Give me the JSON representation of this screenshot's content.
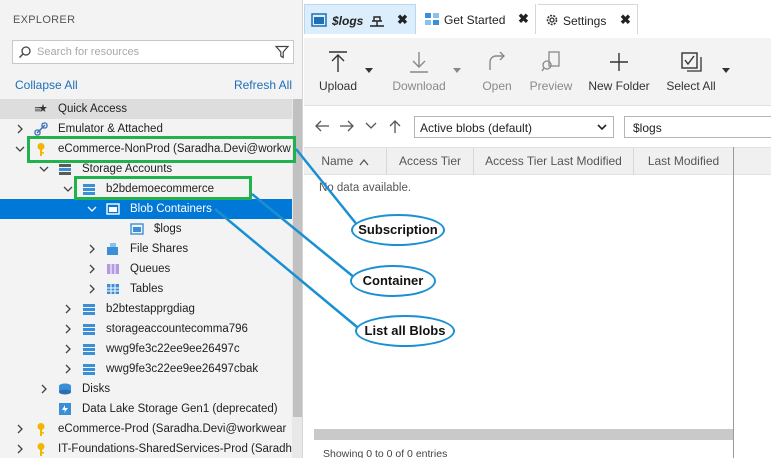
{
  "explorer": {
    "title": "EXPLORER",
    "search_placeholder": "Search for resources",
    "collapse_all": "Collapse All",
    "refresh_all": "Refresh All"
  },
  "tree": {
    "quick_access": "Quick Access",
    "emulator": "Emulator & Attached",
    "subscription": "eCommerce-NonProd (Saradha.Devi@workw",
    "storage_accounts": "Storage Accounts",
    "account": "b2bdemoecommerce",
    "blob_containers": "Blob Containers",
    "logs_container": "$logs",
    "file_shares": "File Shares",
    "queues": "Queues",
    "tables": "Tables",
    "acct2": "b2btestapprgdiag",
    "acct3": "storageaccountecomma796",
    "acct4": "wwg9fe3c22ee9ee26497c",
    "acct5": "wwg9fe3c22ee9ee26497cbak",
    "disks": "Disks",
    "datalake": "Data Lake Storage Gen1 (deprecated)",
    "sub2": "eCommerce-Prod (Saradha.Devi@workwear",
    "sub3": "IT-Foundations-SharedServices-Prod (Saradh"
  },
  "tabs": [
    {
      "label": "$logs",
      "close": "✖"
    },
    {
      "label": "Get Started",
      "close": "✖"
    },
    {
      "label": "Settings",
      "close": "✖"
    }
  ],
  "toolbar": {
    "upload": "Upload",
    "download": "Download",
    "open": "Open",
    "preview": "Preview",
    "new_folder": "New Folder",
    "select_all": "Select All"
  },
  "address": {
    "view_select": "Active blobs (default)",
    "path": "$logs"
  },
  "grid": {
    "columns": [
      "Name",
      "Access Tier",
      "Access Tier Last Modified",
      "Last Modified"
    ],
    "sort_indicator": "^",
    "empty_text": "No data available.",
    "status": "Showing 0 to 0 of 0 entries"
  },
  "annotations": {
    "subscription": "Subscription",
    "container": "Container",
    "list_blobs": "List all Blobs"
  },
  "colors": {
    "accent": "#0078d7",
    "annotation_green": "#23b14d",
    "annotation_blue": "#1a90d2"
  }
}
